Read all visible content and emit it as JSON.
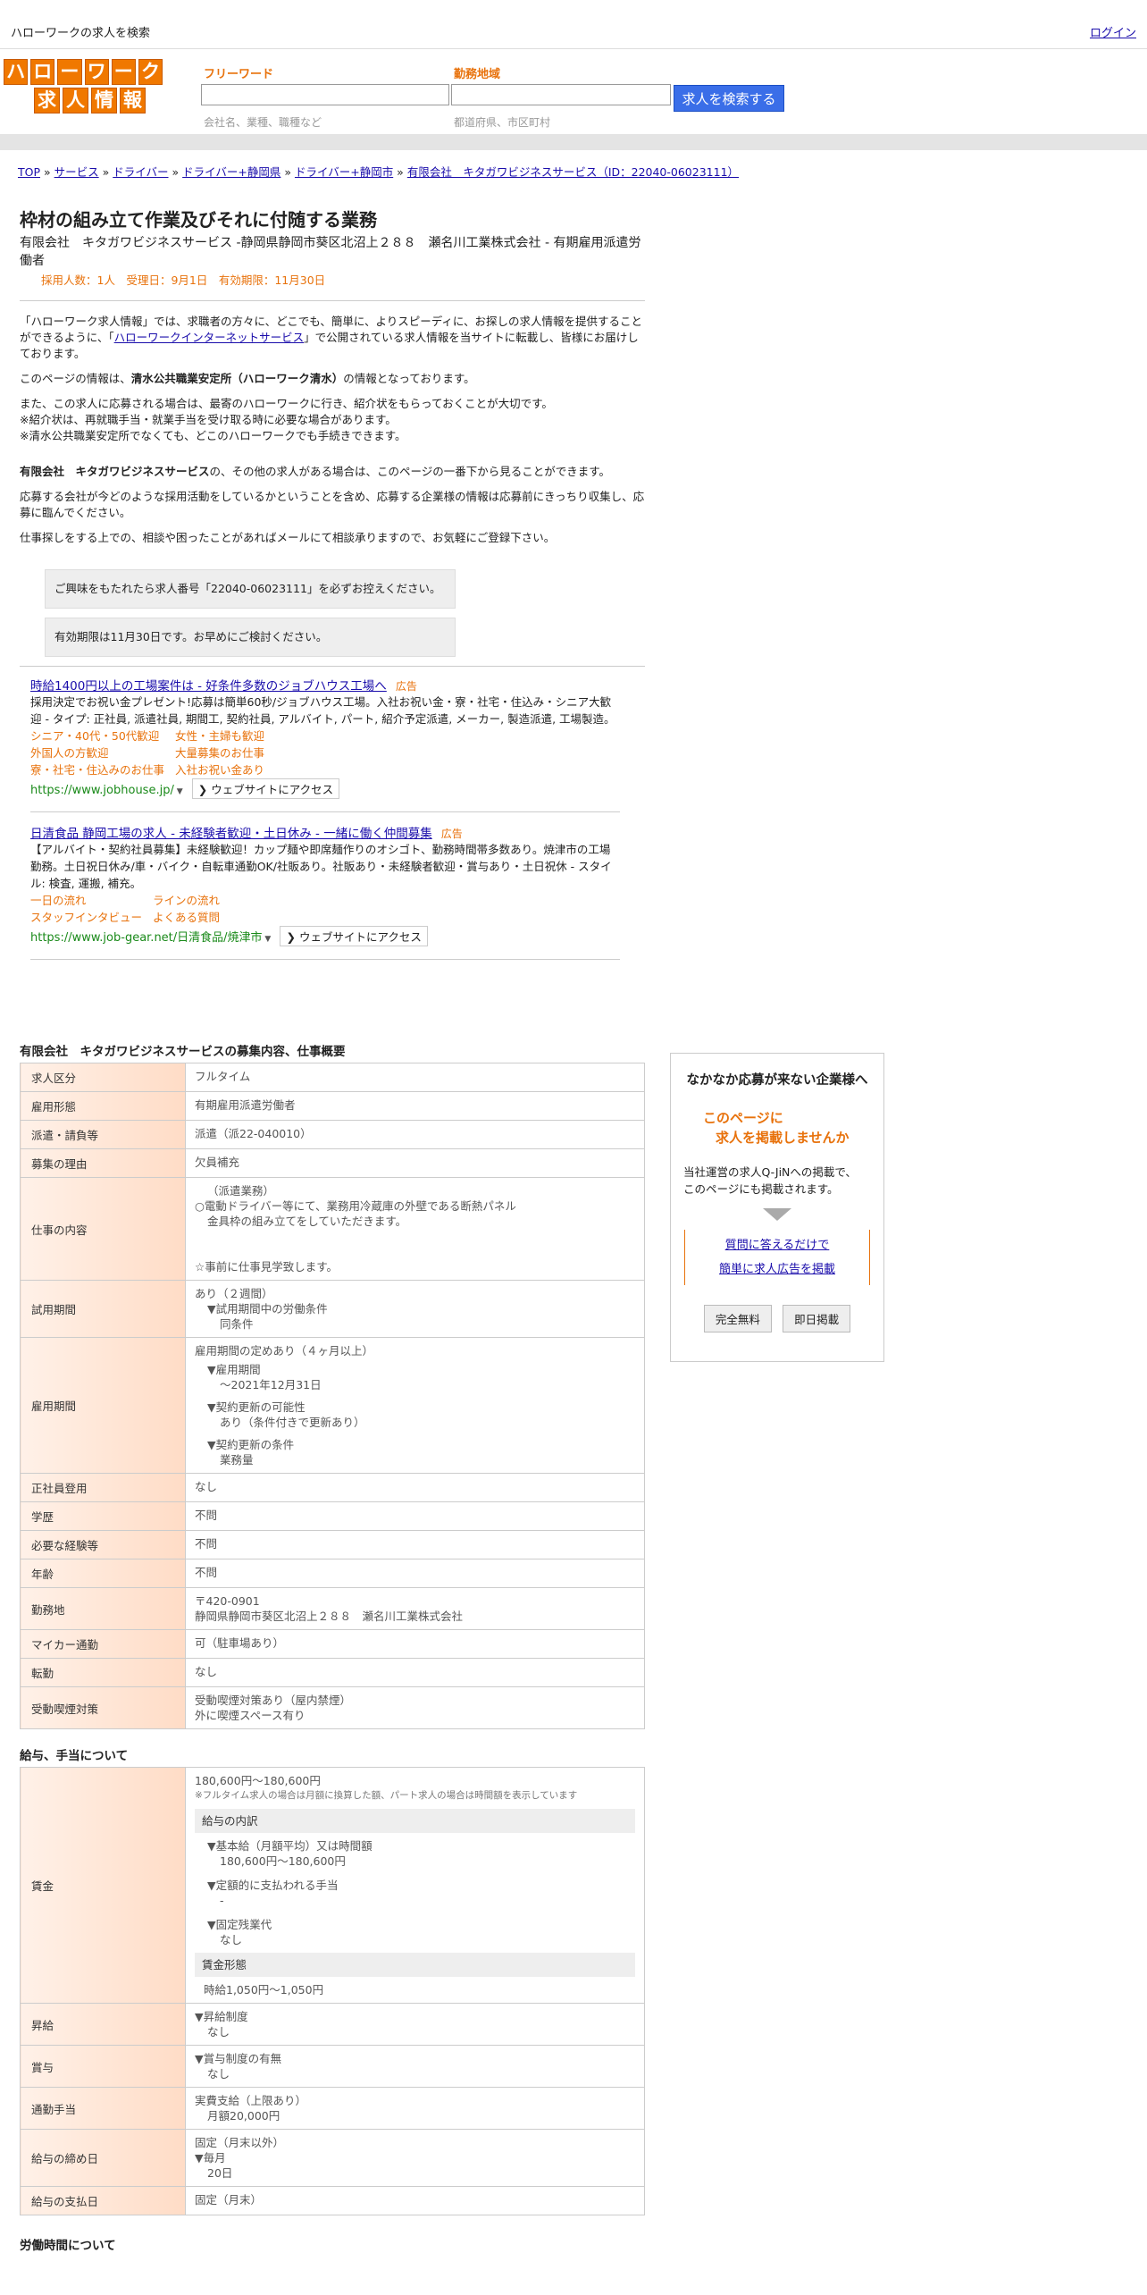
{
  "header": {
    "title": "ハローワークの求人を検索",
    "login": "ログイン"
  },
  "logo": {
    "row1": [
      "ハ",
      "ロ",
      "ー",
      "ワ",
      "ー",
      "ク"
    ],
    "row2": [
      "求",
      "人",
      "情",
      "報"
    ]
  },
  "search": {
    "keyword_label": "フリーワード",
    "keyword_hint": "会社名、業種、職種など",
    "area_label": "勤務地域",
    "area_hint": "都道府県、市区町村",
    "button": "求人を検索する"
  },
  "breadcrumb": [
    "TOP",
    "サービス",
    "ドライバー",
    "ドライバー+静岡県",
    "ドライバー+静岡市",
    "有限会社　キタガワビジネスサービス（ID：22040-06023111）"
  ],
  "job": {
    "title": "枠材の組み立て作業及びそれに付随する業務",
    "company_line": "有限会社　キタガワビジネスサービス -静岡県静岡市葵区北沼上２８８　瀬名川工業株式会社 - 有期雇用派遣労働者",
    "meta": "採用人数：1人　受理日：9月1日　有効期限：11月30日"
  },
  "intro": {
    "p1a": "「ハローワーク求人情報」では、求職者の方々に、どこでも、簡単に、よりスピーディに、お探しの求人情報を提供することができるように、「",
    "p1link": "ハローワークインターネットサービス",
    "p1b": "」で公開されている求人情報を当サイトに転載し、皆様にお届けしております。",
    "p2a": "このページの情報は、",
    "p2b": "清水公共職業安定所（ハローワーク清水）",
    "p2c": "の情報となっております。",
    "p3": "また、この求人に応募される場合は、最寄のハローワークに行き、紹介状をもらっておくことが大切です。",
    "p3b": "※紹介状は、再就職手当・就業手当を受け取る時に必要な場合があります。",
    "p3c": "※清水公共職業安定所でなくても、どこのハローワークでも手続きできます。",
    "p4a": "有限会社　キタガワビジネスサービス",
    "p4b": "の、その他の求人がある場合は、このページの一番下から見ることができます。",
    "p5": "応募する会社が今どのような採用活動をしているかということを含め、応募する企業様の情報は応募前にきっちり収集し、応募に臨んでください。",
    "p6": "仕事探しをする上での、相談や困ったことがあればメールにて相談承りますので、お気軽にご登録下さい。",
    "note1": "ご興味をもたれたら求人番号「22040-06023111」を必ずお控えください。",
    "note2": "有効期限は11月30日です。お早めにご検討ください。"
  },
  "ads": [
    {
      "title": "時給1400円以上の工場案件は - 好条件多数のジョブハウス工場へ",
      "badge": "広告",
      "desc": "採用決定でお祝い金プレゼント!応募は簡単60秒/ジョブハウス工場。入社お祝い金・寮・社宅・住込み・シニア大歓迎 - タイプ: 正社員, 派遣社員, 期間工, 契約社員, アルバイト, パート, 紹介予定派遣, メーカー, 製造派遣, 工場製造。",
      "links": [
        "シニア・40代・50代歓迎",
        "女性・主婦も歓迎",
        "外国人の方歓迎",
        "大量募集のお仕事",
        "寮・社宅・住込みのお仕事",
        "入社お祝い金あり"
      ],
      "url": "https://www.jobhouse.jp/",
      "visit": "ウェブサイトにアクセス"
    },
    {
      "title": "日清食品 静岡工場の求人 - 未経験者歓迎・土日休み - 一緒に働く仲間募集",
      "badge": "広告",
      "desc": "【アルバイト・契約社員募集】未経験歓迎！カップ麺や即席麺作りのオシゴト、勤務時間帯多数あり。焼津市の工場勤務。土日祝日休み/車・バイク・自転車通勤OK/社販あり。社販あり・未経験者歓迎・賞与あり・土日祝休 - スタイル: 検査, 運搬, 補充。",
      "links": [
        "一日の流れ",
        "ラインの流れ",
        "スタッフインタビュー",
        "よくある質問"
      ],
      "url": "https://www.job-gear.net/日清食品/焼津市",
      "visit": "ウェブサイトにアクセス"
    }
  ],
  "detail": {
    "section_title": "有限会社　キタガワビジネスサービスの募集内容、仕事概要",
    "rows": {
      "kubun": [
        "求人区分",
        "フルタイム"
      ],
      "keitai": [
        "雇用形態",
        "有期雇用派遣労働者"
      ],
      "haken": [
        "派遣・請負等",
        "派遣（派22-040010）"
      ],
      "riyu": [
        "募集の理由",
        "欠員補充"
      ],
      "shigoto_h": "仕事の内容",
      "shigoto": [
        "（派遣業務）",
        "○電動ドライバー等にて、業務用冷蔵庫の外壁である断熱パネル",
        "金具枠の組み立てをしていただきます。",
        "☆事前に仕事見学致します。"
      ],
      "shiyo_h": "試用期間",
      "shiyo": [
        "あり（２週間）",
        "▼試用期間中の労働条件",
        "同条件"
      ],
      "kikan_h": "雇用期間",
      "kikan": [
        "雇用期間の定めあり（４ヶ月以上）",
        "▼雇用期間",
        "〜2021年12月31日",
        "▼契約更新の可能性",
        "あり（条件付きで更新あり）",
        "▼契約更新の条件",
        "業務量"
      ],
      "seishain": [
        "正社員登用",
        "なし"
      ],
      "gakureki": [
        "学歴",
        "不問"
      ],
      "keiken": [
        "必要な経験等",
        "不問"
      ],
      "nenrei": [
        "年齢",
        "不問"
      ],
      "kinmuchi_h": "勤務地",
      "kinmuchi": [
        "〒420-0901",
        "静岡県静岡市葵区北沼上２８８　瀬名川工業株式会社"
      ],
      "mycar": [
        "マイカー通勤",
        "可（駐車場あり）"
      ],
      "tenkin": [
        "転勤",
        "なし"
      ],
      "judo_h": "受動喫煙対策",
      "judo": [
        "受動喫煙対策あり（屋内禁煙）",
        "外に喫煙スペース有り"
      ]
    },
    "pay_title": "給与、手当について",
    "pay": {
      "chingin_h": "賃金",
      "chingin_v": "180,600円〜180,600円",
      "chingin_note": "※フルタイム求人の場合は月額に換算した額、パート求人の場合は時間額を表示しています",
      "breakdown_h": "給与の内訳",
      "breakdown": [
        "▼基本給（月額平均）又は時間額",
        "180,600円〜180,600円",
        "▼定額的に支払われる手当",
        "-",
        "▼固定残業代",
        "なし"
      ],
      "keitai_h": "賃金形態",
      "keitai_v": "時給1,050円〜1,050円",
      "shokyu_h": "昇給",
      "shokyu": [
        "▼昇給制度",
        "なし"
      ],
      "shoyo_h": "賞与",
      "shoyo": [
        "▼賞与制度の有無",
        "なし"
      ],
      "tsukin_h": "通勤手当",
      "tsukin": [
        "実費支給（上限あり）",
        "月額20,000円"
      ],
      "shime_h": "給与の締め日",
      "shime": [
        "固定（月末以外）",
        "▼毎月",
        "20日"
      ],
      "shiharai": [
        "給与の支払日",
        "固定（月末）"
      ]
    },
    "hours_title": "労働時間について"
  },
  "side": {
    "heading": "なかなか応募が来ない企業様へ",
    "offer1": "このページに",
    "offer2": "求人を掲載しませんか",
    "desc1": "当社運営の求人Q-JiNへの掲載で、",
    "desc2": "このページにも掲載されます。",
    "link1": "質問に答えるだけで",
    "link2": "簡単に求人広告を掲載",
    "btn1": "完全無料",
    "btn2": "即日掲載"
  }
}
